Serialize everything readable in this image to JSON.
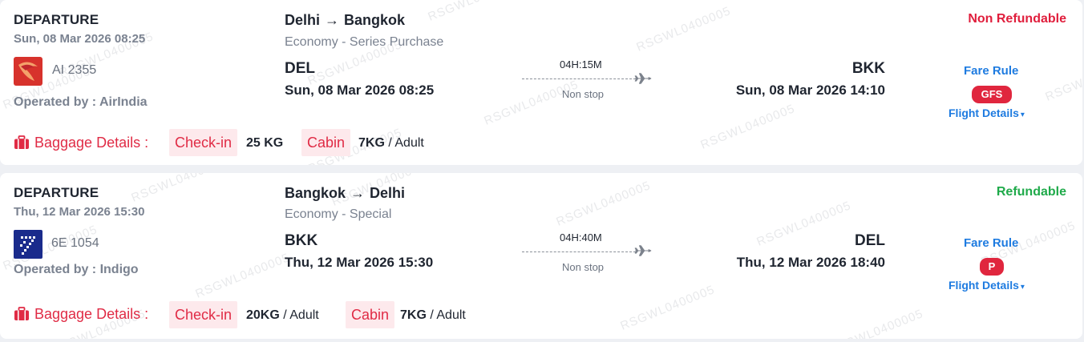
{
  "watermark": "RSGWL0400005",
  "segments": [
    {
      "label": "DEPARTURE",
      "datetime": "Sun, 08 Mar 2026 08:25",
      "airline_logo": "airindia-logo",
      "flight_no": "AI 2355",
      "operated_by": "Operated by : AirIndia",
      "origin_city": "Delhi",
      "dest_city": "Bangkok",
      "fare_class": "Economy - Series Purchase",
      "origin_code": "DEL",
      "origin_datetime": "Sun, 08 Mar 2026 08:25",
      "duration": "04H:15M",
      "stops": "Non stop",
      "dest_code": "BKK",
      "dest_datetime": "Sun, 08 Mar 2026 14:10",
      "refund_status": "Non Refundable",
      "refund_color": "#e01e3c",
      "fare_rule": "Fare Rule",
      "fare_badge": "GFS",
      "flight_details": "Flight Details",
      "baggage_label": "Baggage Details :",
      "checkin_label": "Check-in",
      "checkin_value": "25 KG",
      "checkin_suffix": "",
      "cabin_label": "Cabin",
      "cabin_value": "7KG",
      "cabin_suffix": "/ Adult"
    },
    {
      "label": "DEPARTURE",
      "datetime": "Thu, 12 Mar 2026 15:30",
      "airline_logo": "indigo-logo",
      "flight_no": "6E 1054",
      "operated_by": "Operated by : Indigo",
      "origin_city": "Bangkok",
      "dest_city": "Delhi",
      "fare_class": "Economy - Special",
      "origin_code": "BKK",
      "origin_datetime": "Thu, 12 Mar 2026 15:30",
      "duration": "04H:40M",
      "stops": "Non stop",
      "dest_code": "DEL",
      "dest_datetime": "Thu, 12 Mar 2026 18:40",
      "refund_status": "Refundable",
      "refund_color": "#1faa4a",
      "fare_rule": "Fare Rule",
      "fare_badge": "P",
      "flight_details": "Flight Details",
      "baggage_label": "Baggage Details :",
      "checkin_label": "Check-in",
      "checkin_value": "20KG",
      "checkin_suffix": "/ Adult",
      "cabin_label": "Cabin",
      "cabin_value": "7KG",
      "cabin_suffix": "/ Adult"
    }
  ]
}
